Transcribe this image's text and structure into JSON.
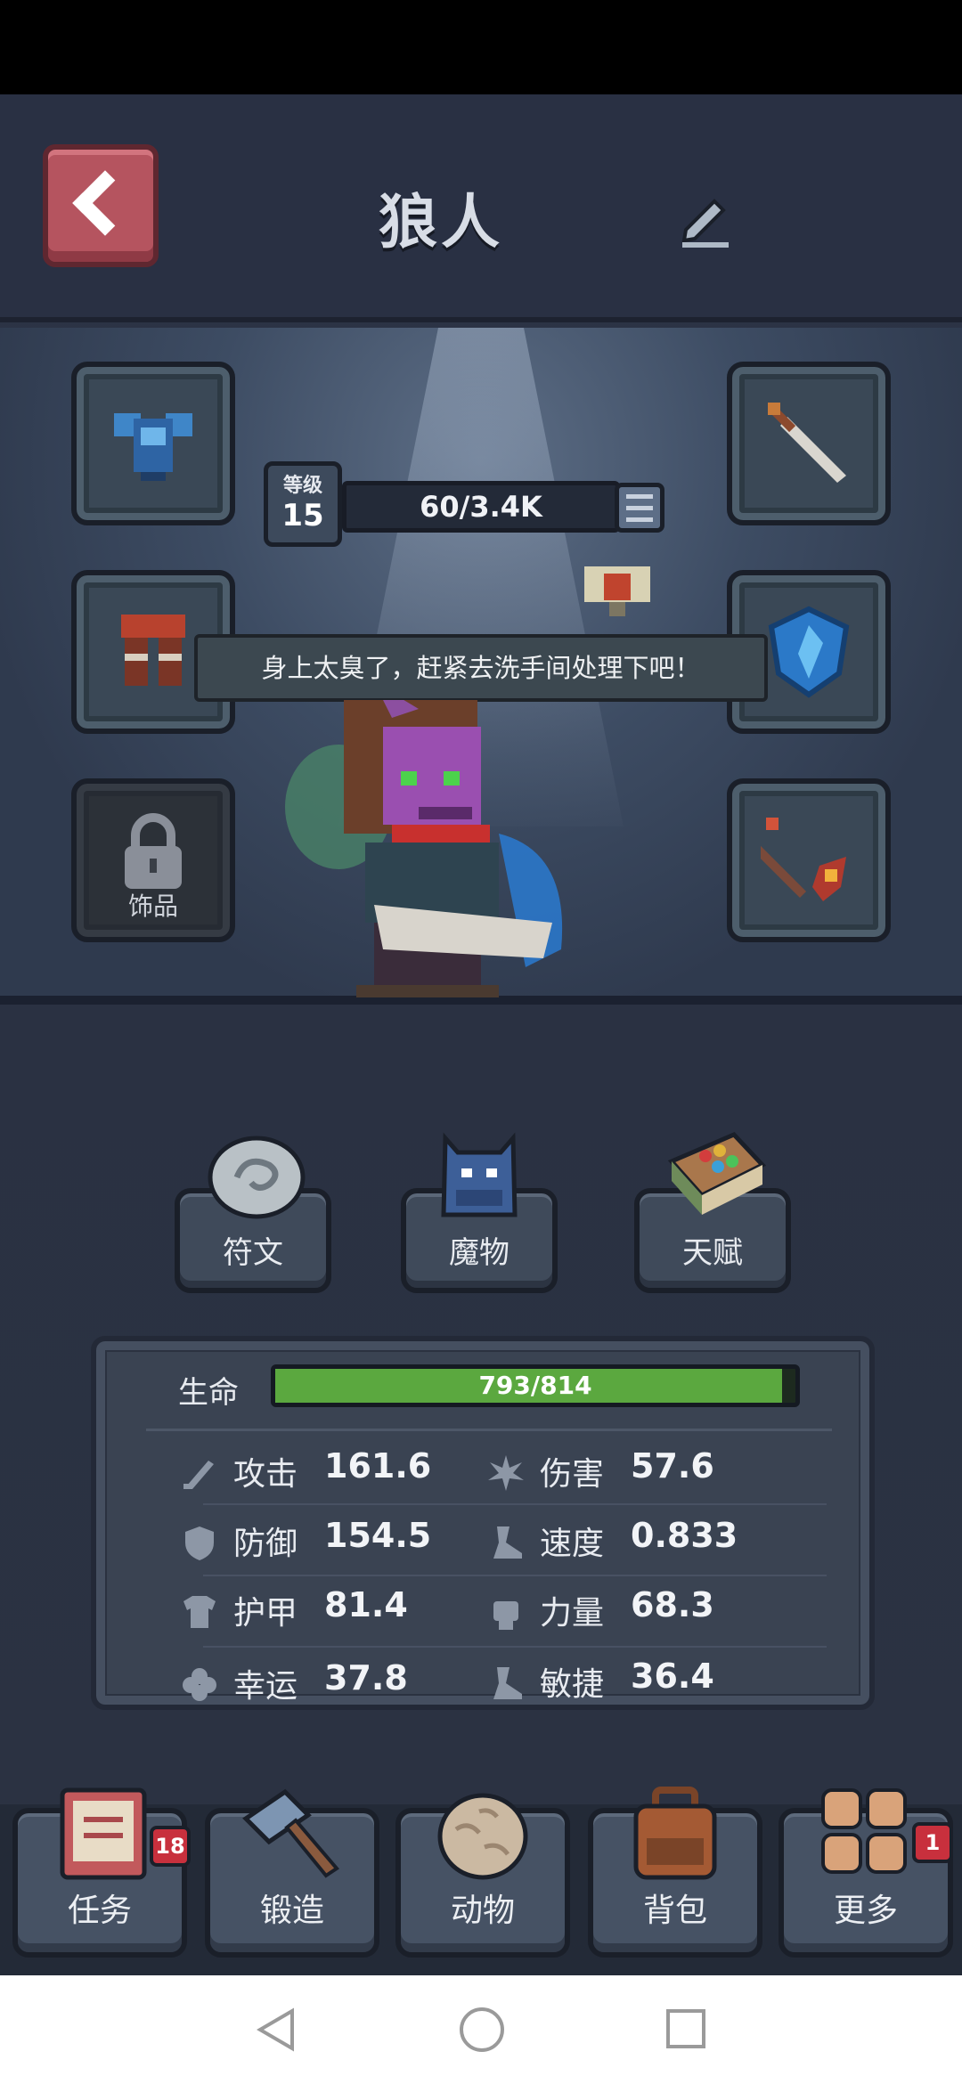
{
  "header": {
    "title": "狼人",
    "back_icon": "back-chevron-icon",
    "edit_icon": "edit-pencil-icon"
  },
  "level": {
    "label": "等级",
    "value": "15",
    "xp_text": "60/3.4K"
  },
  "speech": "身上太臭了，赶紧去洗手间处理下吧！",
  "equipment": {
    "armor_icon": "blue-armor-icon",
    "legs_icon": "leg-armor-icon",
    "accessory_label": "饰品",
    "weapon_icon": "sword-icon",
    "shield_icon": "blue-shield-icon",
    "staff_icon": "staff-icon"
  },
  "sub_buttons": [
    {
      "label": "符文",
      "icon": "rune-stone-icon"
    },
    {
      "label": "魔物",
      "icon": "monster-icon"
    },
    {
      "label": "天赋",
      "icon": "talent-book-icon"
    }
  ],
  "stats": {
    "hp_label": "生命",
    "hp_text": "793/814",
    "hp_current": 793,
    "hp_max": 814,
    "items": [
      {
        "name": "攻击",
        "value": "161.6",
        "icon": "sword-icon"
      },
      {
        "name": "伤害",
        "value": "57.6",
        "icon": "burst-icon"
      },
      {
        "name": "防御",
        "value": "154.5",
        "icon": "shield-icon"
      },
      {
        "name": "速度",
        "value": "0.833",
        "icon": "boot-icon"
      },
      {
        "name": "护甲",
        "value": "81.4",
        "icon": "armor-icon"
      },
      {
        "name": "力量",
        "value": "68.3",
        "icon": "fist-icon"
      },
      {
        "name": "幸运",
        "value": "37.8",
        "icon": "clover-icon"
      },
      {
        "name": "敏捷",
        "value": "36.4",
        "icon": "boot-icon"
      }
    ]
  },
  "nav": [
    {
      "label": "任务",
      "badge": "18",
      "icon": "quest-book-icon"
    },
    {
      "label": "锻造",
      "badge": "",
      "icon": "hammer-icon"
    },
    {
      "label": "动物",
      "badge": "",
      "icon": "egg-icon"
    },
    {
      "label": "背包",
      "badge": "",
      "icon": "backpack-icon"
    },
    {
      "label": "更多",
      "badge": "1",
      "icon": "grid-icon"
    }
  ],
  "colors": {
    "hp_green": "#5ba83f",
    "badge_red": "#c8303d",
    "back_button": "#b5545f"
  }
}
